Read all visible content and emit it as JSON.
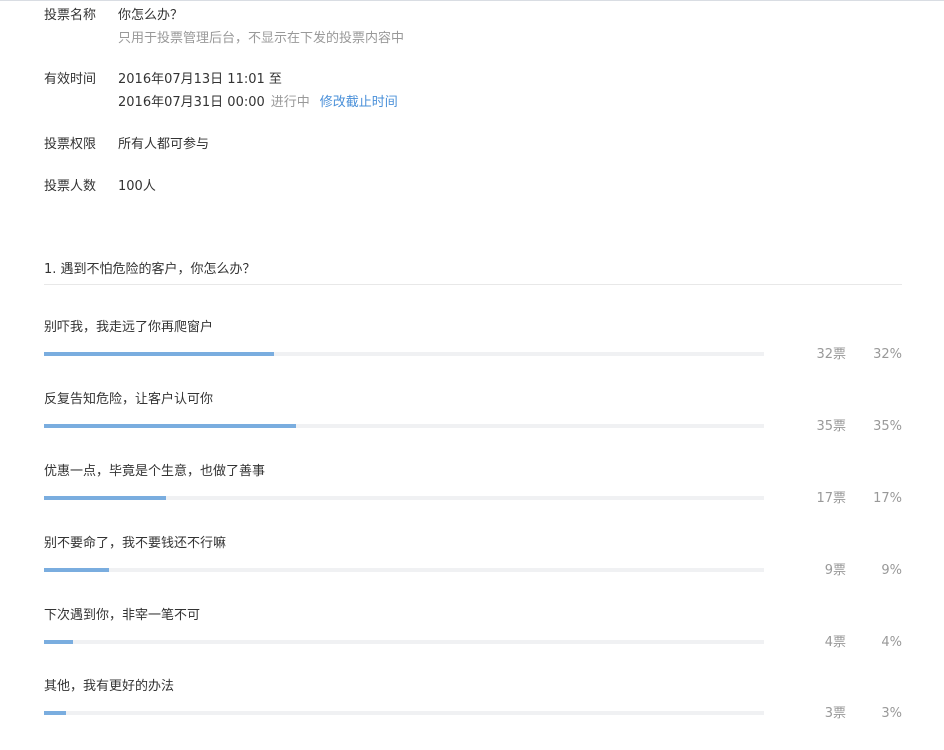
{
  "vote": {
    "name_label": "投票名称",
    "name_value": "你怎么办？",
    "name_hint": "只用于投票管理后台，不显示在下发的投票内容中",
    "time_label": "有效时间",
    "time_start": "2016年07月13日 11:01 至",
    "time_end": "2016年07月31日 00:00",
    "status": "进行中",
    "edit_deadline": "修改截止时间",
    "permission_label": "投票权限",
    "permission_value": "所有人都可参与",
    "count_label": "投票人数",
    "count_value": "100人"
  },
  "question": {
    "title": "1. 遇到不怕危险的客户，你怎么办？",
    "options": [
      {
        "label": "别吓我，我走远了你再爬窗户",
        "votes": "32票",
        "percent": "32%",
        "fraction": 0.32
      },
      {
        "label": "反复告知危险，让客户认可你",
        "votes": "35票",
        "percent": "35%",
        "fraction": 0.35
      },
      {
        "label": "优惠一点，毕竟是个生意，也做了善事",
        "votes": "17票",
        "percent": "17%",
        "fraction": 0.17
      },
      {
        "label": "别不要命了，我不要钱还不行嘛",
        "votes": "9票",
        "percent": "9%",
        "fraction": 0.09
      },
      {
        "label": "下次遇到你，非宰一笔不可",
        "votes": "4票",
        "percent": "4%",
        "fraction": 0.04
      },
      {
        "label": "其他，我有更好的办法",
        "votes": "3票",
        "percent": "3%",
        "fraction": 0.03
      }
    ]
  },
  "colors": {
    "bar_fill": "#7aaddf",
    "bar_track": "#f0f1f3",
    "link": "#4a90d9"
  }
}
